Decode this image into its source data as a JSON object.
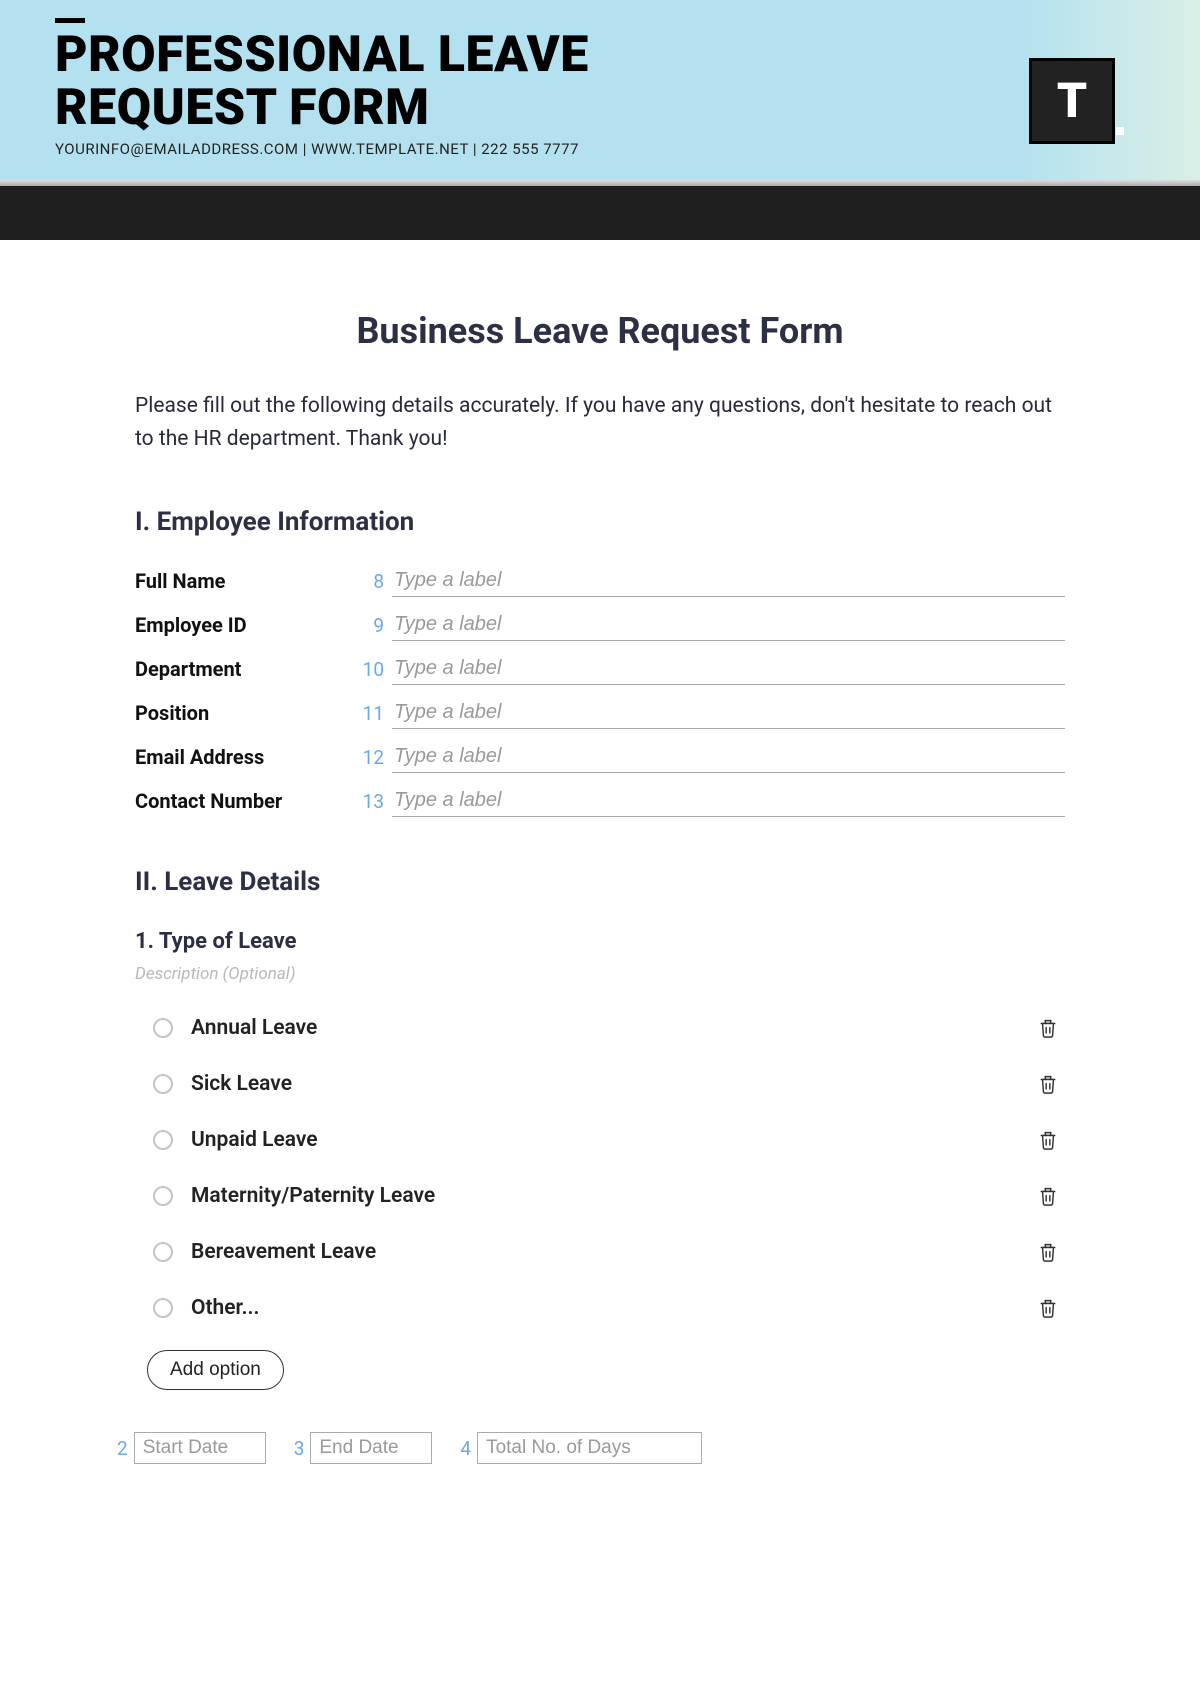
{
  "banner": {
    "title_line1": "PROFESSIONAL LEAVE",
    "title_line2": "REQUEST FORM",
    "contact": "YOURINFO@EMAILADDRESS.COM | WWW.TEMPLATE.NET | 222 555 7777",
    "logo_letter": "T"
  },
  "form": {
    "title": "Business Leave Request Form",
    "intro": "Please fill out the following details accurately. If you have any questions, don't hesitate to reach out to the HR department. Thank you!"
  },
  "section1": {
    "heading": "I. Employee Information",
    "fields": [
      {
        "label": "Full Name",
        "num": "8",
        "placeholder": "Type a label"
      },
      {
        "label": "Employee ID",
        "num": "9",
        "placeholder": "Type a label"
      },
      {
        "label": "Department",
        "num": "10",
        "placeholder": "Type a label"
      },
      {
        "label": "Position",
        "num": "11",
        "placeholder": "Type a label"
      },
      {
        "label": "Email Address",
        "num": "12",
        "placeholder": "Type a label"
      },
      {
        "label": "Contact Number",
        "num": "13",
        "placeholder": "Type a label"
      }
    ]
  },
  "section2": {
    "heading": "II. Leave Details",
    "q1_title": "1. Type of Leave",
    "desc_placeholder": "Description (Optional)",
    "options": [
      "Annual Leave",
      "Sick Leave",
      "Unpaid Leave",
      "Maternity/Paternity Leave",
      "Bereavement Leave",
      "Other..."
    ],
    "add_option": "Add option",
    "dates": [
      {
        "num": "2",
        "placeholder": "Start Date",
        "cls": "w-sd"
      },
      {
        "num": "3",
        "placeholder": "End Date",
        "cls": "w-ed"
      },
      {
        "num": "4",
        "placeholder": "Total No. of Days",
        "cls": "w-td"
      }
    ]
  }
}
